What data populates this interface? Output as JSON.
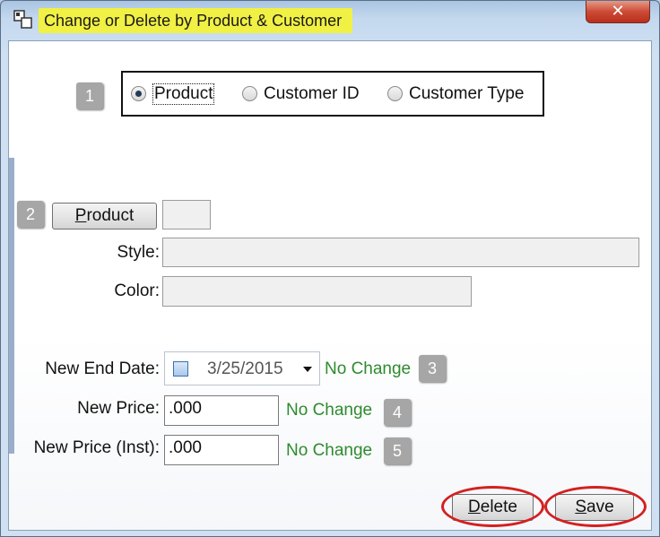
{
  "window": {
    "title": "Change or Delete by Product & Customer",
    "close_label": "✕"
  },
  "steps": [
    "1",
    "2",
    "3",
    "4",
    "5"
  ],
  "search_by": {
    "options": [
      "Product",
      "Customer ID",
      "Customer Type"
    ],
    "selected": "Product"
  },
  "product": {
    "button_label": "Product",
    "code_value": "",
    "style_label": "Style:",
    "style_value": "",
    "color_label": "Color:",
    "color_value": ""
  },
  "end_date": {
    "label": "New End Date:",
    "value": "3/25/2015",
    "checked": false,
    "status": "No Change"
  },
  "price": {
    "label": "New Price:",
    "value": ".000",
    "status": "No Change"
  },
  "price_inst": {
    "label": "New Price (Inst):",
    "value": ".000",
    "status": "No Change"
  },
  "actions": {
    "delete_label": "Delete",
    "save_label": "Save"
  },
  "colors": {
    "title_highlight": "#f1f044",
    "status_green": "#2e8b2e",
    "annotation_red": "#d42020",
    "step_badge": "#a6a6a6"
  }
}
